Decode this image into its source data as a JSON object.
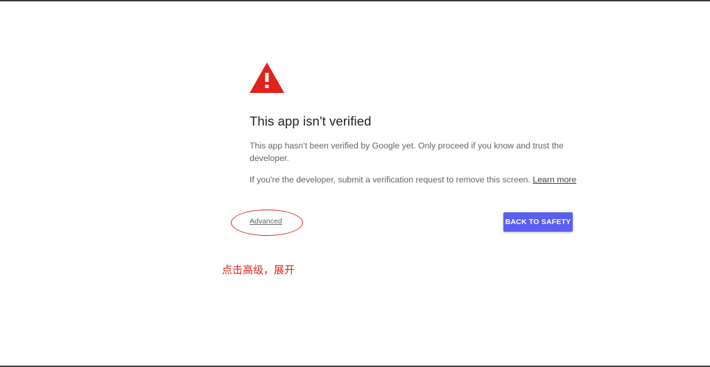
{
  "page": {
    "title": "This app isn't verified",
    "description": "This app hasn't been verified by Google yet. Only proceed if you know and trust the developer.",
    "developer_text": "If you're the developer, submit a verification request to remove this screen. ",
    "learn_more_label": "Learn more",
    "warning_icon": "warning-triangle-icon",
    "warning_color": "#e0241b"
  },
  "actions": {
    "advanced_label": "Advanced",
    "back_to_safety_label": "BACK TO SAFETY",
    "button_color": "#5a5ff2"
  },
  "annotation": {
    "note": "点击高级，展开",
    "color": "#e0241b"
  }
}
